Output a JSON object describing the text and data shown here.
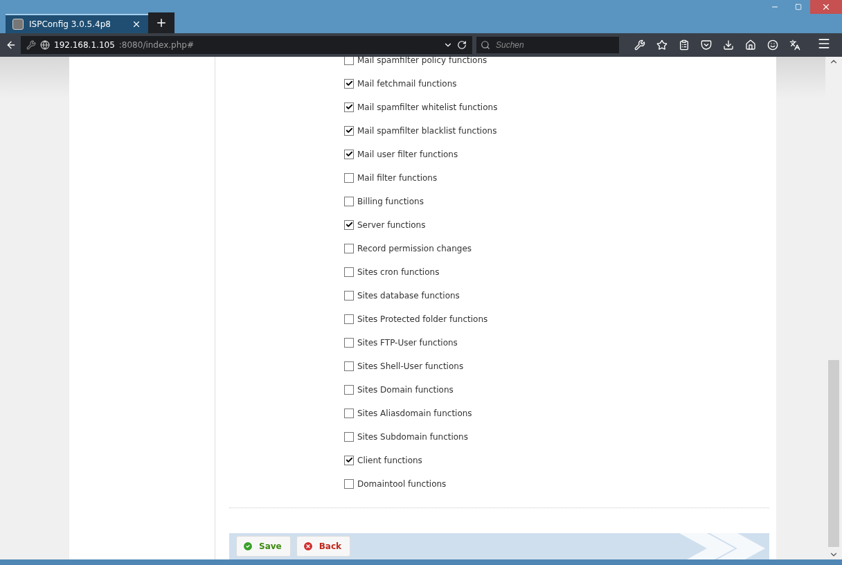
{
  "tab": {
    "title": "ISPConfig 3.0.5.4p8"
  },
  "address": {
    "host": "192.168.1.105",
    "rest": ":8080/index.php#"
  },
  "search": {
    "placeholder": "Suchen"
  },
  "permissions": [
    {
      "label": "Mail spamfilter policy functions",
      "checked": false
    },
    {
      "label": "Mail fetchmail functions",
      "checked": true
    },
    {
      "label": "Mail spamfilter whitelist functions",
      "checked": true
    },
    {
      "label": "Mail spamfilter blacklist functions",
      "checked": true
    },
    {
      "label": "Mail user filter functions",
      "checked": true
    },
    {
      "label": "Mail filter functions",
      "checked": false
    },
    {
      "label": "Billing functions",
      "checked": false
    },
    {
      "label": "Server functions",
      "checked": true
    },
    {
      "label": "Record permission changes",
      "checked": false
    },
    {
      "label": "Sites cron functions",
      "checked": false
    },
    {
      "label": "Sites database functions",
      "checked": false
    },
    {
      "label": "Sites Protected folder functions",
      "checked": false
    },
    {
      "label": "Sites FTP-User functions",
      "checked": false
    },
    {
      "label": "Sites Shell-User functions",
      "checked": false
    },
    {
      "label": "Sites Domain functions",
      "checked": false
    },
    {
      "label": "Sites Aliasdomain functions",
      "checked": false
    },
    {
      "label": "Sites Subdomain functions",
      "checked": false
    },
    {
      "label": "Client functions",
      "checked": true
    },
    {
      "label": "Domaintool functions",
      "checked": false
    }
  ],
  "buttons": [
    {
      "kind": "save",
      "label": "Save"
    },
    {
      "kind": "back",
      "label": "Back"
    }
  ]
}
